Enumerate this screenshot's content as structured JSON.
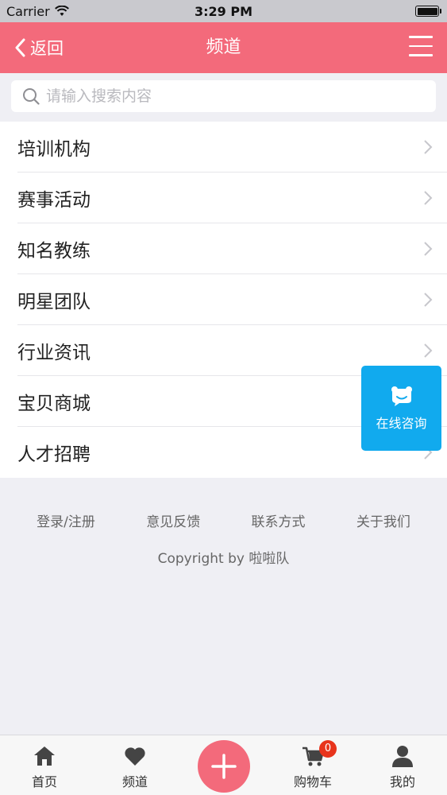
{
  "status_bar": {
    "carrier": "Carrier",
    "time": "3:29 PM"
  },
  "nav": {
    "back_label": "返回",
    "title": "频道"
  },
  "search": {
    "placeholder": "请输入搜索内容"
  },
  "list": {
    "items": [
      {
        "label": "培训机构"
      },
      {
        "label": "赛事活动"
      },
      {
        "label": "知名教练"
      },
      {
        "label": "明星团队"
      },
      {
        "label": "行业资讯"
      },
      {
        "label": "宝贝商城"
      },
      {
        "label": "人才招聘"
      }
    ]
  },
  "consult": {
    "label": "在线咨询",
    "color": "#11aaee"
  },
  "footer": {
    "links": [
      {
        "label": "登录/注册"
      },
      {
        "label": "意见反馈"
      },
      {
        "label": "联系方式"
      },
      {
        "label": "关于我们"
      }
    ],
    "copyright": "Copyright by 啦啦队"
  },
  "tabbar": {
    "home": "首页",
    "channel": "频道",
    "cart": "购物车",
    "cart_count": "0",
    "mine": "我的"
  },
  "colors": {
    "brand": "#f36a7b",
    "badge": "#e8341c"
  }
}
